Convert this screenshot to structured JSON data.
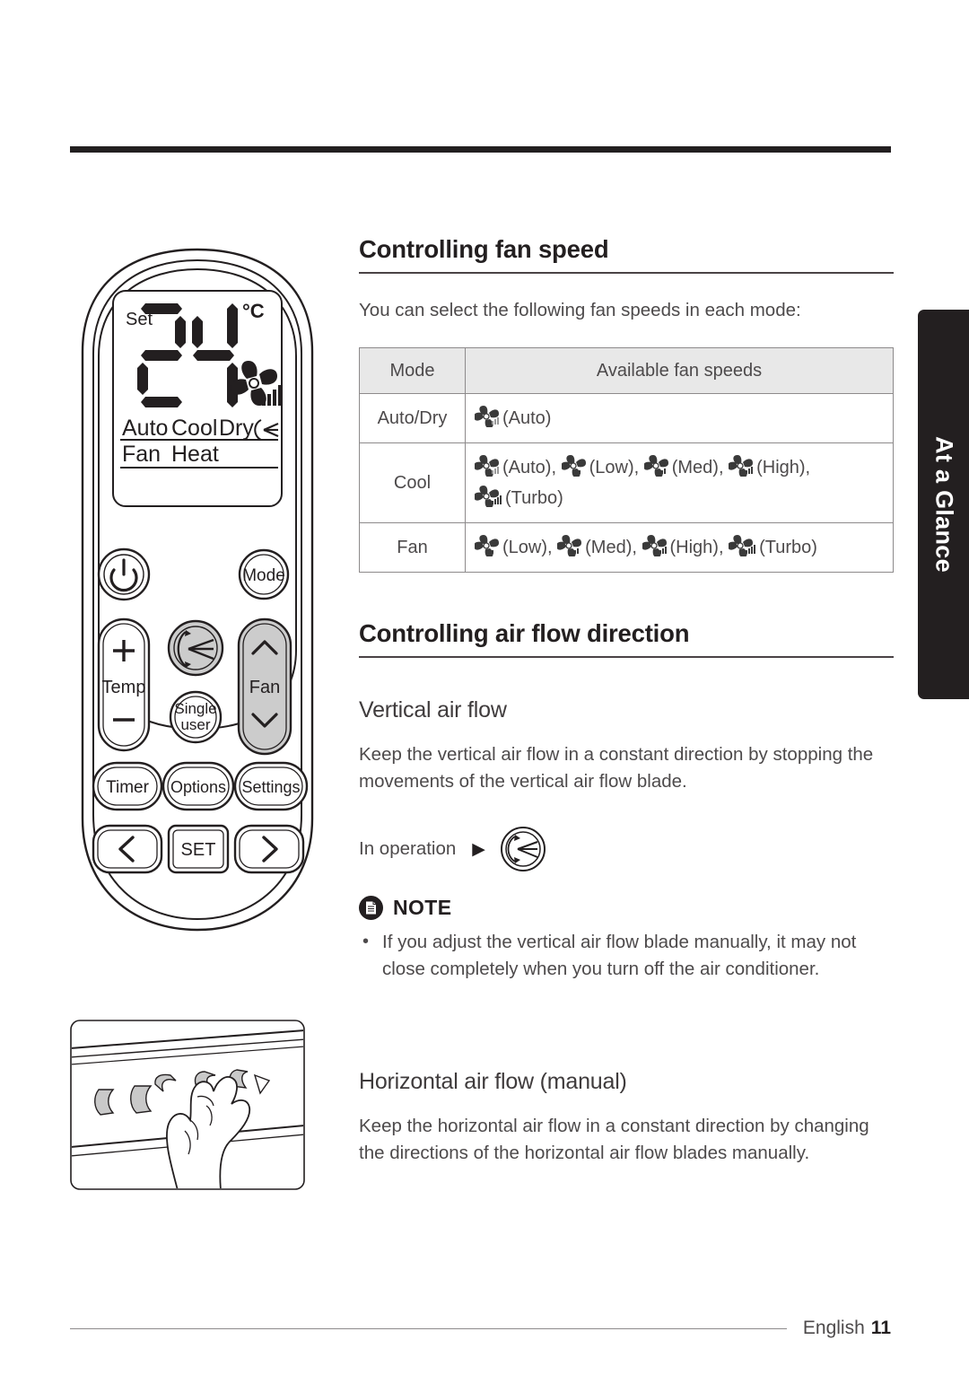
{
  "side_tab": {
    "label": "At a Glance"
  },
  "sections": {
    "fan_speed": {
      "title": "Controlling fan speed",
      "intro": "You can select the following fan speeds in each mode:"
    },
    "air_flow": {
      "title": "Controlling air flow direction"
    },
    "vertical": {
      "title": "Vertical air flow",
      "body": "Keep the vertical air flow in a constant direction by stopping the movements of the vertical air flow blade.",
      "in_operation_label": "In operation",
      "arrow_glyph": "▶"
    },
    "horizontal": {
      "title": "Horizontal air flow (manual)",
      "body": "Keep the horizontal air flow in a constant direction by changing the directions of the horizontal air flow blades manually."
    }
  },
  "note": {
    "icon": "note-document-icon",
    "label": "NOTE",
    "items": [
      "If you adjust the vertical air flow blade manually, it may not close completely when you turn off the air conditioner."
    ]
  },
  "table": {
    "headers": [
      "Mode",
      "Available fan speeds"
    ],
    "rows": [
      {
        "mode": "Auto/Dry",
        "speeds": [
          {
            "bars": 0,
            "label": "(Auto)"
          }
        ]
      },
      {
        "mode": "Cool",
        "speeds": [
          {
            "bars": 0,
            "label": "(Auto),"
          },
          {
            "bars": 1,
            "label": "(Low),"
          },
          {
            "bars": 2,
            "label": "(Med),"
          },
          {
            "bars": 3,
            "label": "(High),"
          },
          {
            "bars": 4,
            "label": "(Turbo)"
          }
        ]
      },
      {
        "mode": "Fan",
        "speeds": [
          {
            "bars": 1,
            "label": "(Low),"
          },
          {
            "bars": 2,
            "label": "(Med),"
          },
          {
            "bars": 3,
            "label": "(High),"
          },
          {
            "bars": 4,
            "label": "(Turbo)"
          }
        ]
      }
    ]
  },
  "remote": {
    "display": {
      "set_label": "Set",
      "temperature": "24",
      "unit": "°C",
      "fan_bars": 4,
      "modes_line1": [
        "Auto",
        "Cool",
        "Dry"
      ],
      "modes_line2": [
        "Fan",
        "Heat"
      ]
    },
    "buttons": [
      {
        "name": "power-button",
        "label": ""
      },
      {
        "name": "mode-button",
        "label": "Mode"
      },
      {
        "name": "temp-button",
        "label": "Temp",
        "plus": "+",
        "minus": "—"
      },
      {
        "name": "swing-button",
        "label": ""
      },
      {
        "name": "single-user-button",
        "label_line1": "Single",
        "label_line2": "user"
      },
      {
        "name": "fan-button",
        "label": "Fan"
      },
      {
        "name": "timer-button",
        "label": "Timer"
      },
      {
        "name": "options-button",
        "label": "Options"
      },
      {
        "name": "settings-button",
        "label": "Settings"
      },
      {
        "name": "left-button",
        "label": ""
      },
      {
        "name": "set-button",
        "label": "SET"
      },
      {
        "name": "right-button",
        "label": ""
      }
    ]
  },
  "footer": {
    "language": "English",
    "page": "11"
  },
  "colors": {
    "ink": "#231f20",
    "body_text": "#4d4a4b",
    "rule": "#8d8a8b",
    "table_header_bg": "#e8e8e8",
    "tab_bg": "#231f20",
    "button_fill": "#cccccc"
  }
}
